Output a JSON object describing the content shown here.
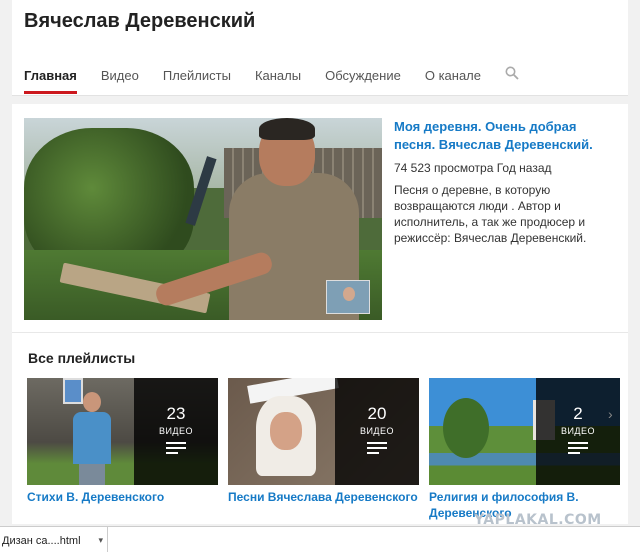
{
  "channel": {
    "title": "Вячеслав Деревенский"
  },
  "tabs": [
    {
      "label": "Главная",
      "active": true
    },
    {
      "label": "Видео"
    },
    {
      "label": "Плейлисты"
    },
    {
      "label": "Каналы"
    },
    {
      "label": "Обсуждение"
    },
    {
      "label": "О канале"
    }
  ],
  "search_icon": "search-icon",
  "featured_video": {
    "title": "Моя деревня. Очень добрая песня. Вячеслав Деревенский.",
    "views": "74 523 просмотра",
    "age": "Год назад",
    "description": "Песня о деревне, в которую возвращаются люди . Автор и исполнитель, а так же продюсер и режиссёр: Вячеслав Деревенский."
  },
  "playlists_section": {
    "title": "Все плейлисты",
    "items": [
      {
        "title": "Стихи В. Деревенского",
        "count": "23",
        "unit": "ВИДЕО"
      },
      {
        "title": "Песни Вячеслава Деревенского",
        "count": "20",
        "unit": "ВИДЕО"
      },
      {
        "title": "Религия и философия В. Деревенского",
        "count": "2",
        "unit": "ВИДЕО"
      }
    ]
  },
  "download_bar": {
    "filename": "Дизан са....html"
  },
  "watermark": "YAPLAKAL.COM",
  "colors": {
    "link": "#167ac6",
    "active_tab": "#cc181e"
  }
}
